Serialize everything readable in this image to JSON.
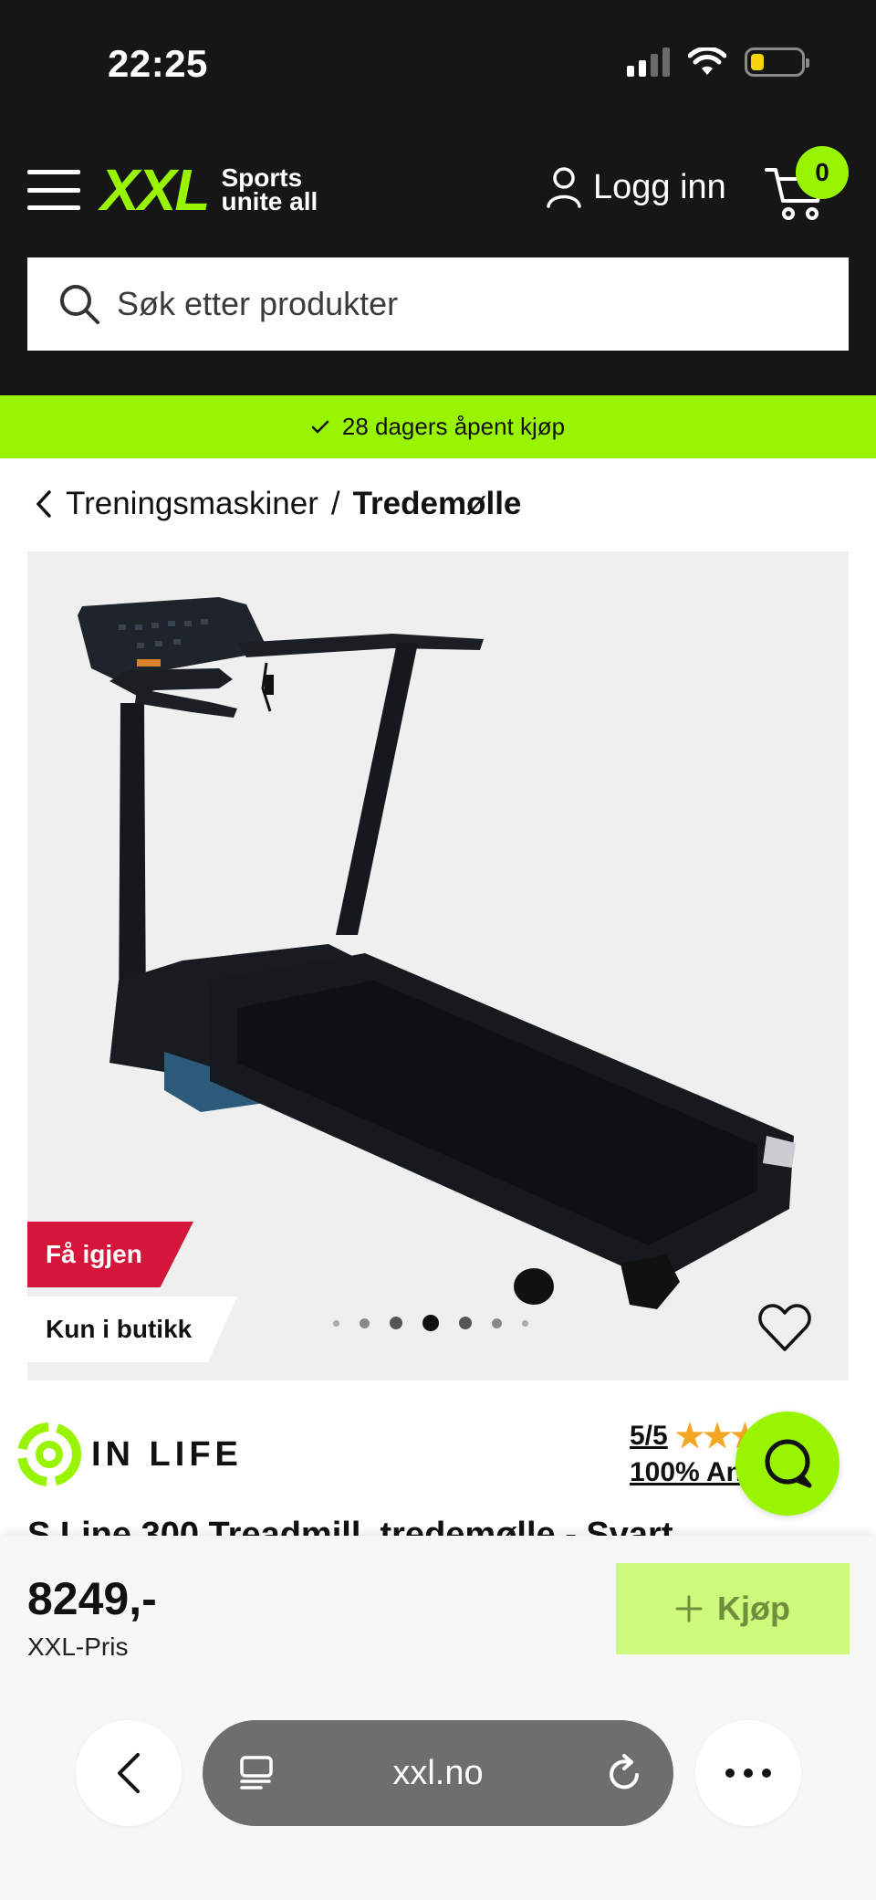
{
  "status_bar": {
    "time": "22:25"
  },
  "header": {
    "logo_mark": "XXL",
    "logo_tagline_1": "Sports",
    "logo_tagline_2": "unite all",
    "login_label": "Logg inn",
    "cart_count": "0"
  },
  "search": {
    "placeholder": "Søk etter produkter"
  },
  "promo_banner": {
    "text": "28 dagers åpent kjøp"
  },
  "breadcrumb": {
    "parent": "Treningsmaskiner",
    "separator": "/",
    "current": "Tredemølle"
  },
  "product": {
    "badges": {
      "restock": "Få igjen",
      "availability": "Kun i butikk"
    },
    "gallery": {
      "count": 7,
      "active_index": 3
    },
    "brand": "IN LIFE",
    "rating": {
      "score": "5/5",
      "stars": 5,
      "recommend": "100% An"
    },
    "title": "S Line 300 Treadmill, tredemølle - Svart",
    "price": "8249,-",
    "price_label": "XXL-Pris",
    "buy_label": "Kjøp"
  },
  "browser": {
    "url": "xxl.no"
  },
  "colors": {
    "brand_green": "#98f400",
    "header_bg": "#161616",
    "badge_red": "#d5163a",
    "star": "#f5a623"
  }
}
